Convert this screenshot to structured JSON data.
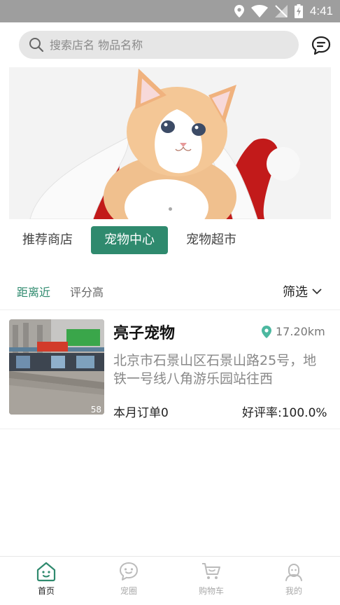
{
  "status_bar": {
    "time": "4:41"
  },
  "search": {
    "placeholder": "搜索店名 物品名称"
  },
  "icons": {
    "search": "search-icon",
    "message": "chat-bubble-icon",
    "location": "location-pin-icon",
    "filter_arrow": "chevron-down-icon"
  },
  "banner": {
    "subject": "kitten",
    "slide_count": 3,
    "active_slide": 2
  },
  "category_tabs": [
    {
      "label": "推荐商店"
    },
    {
      "label": "宠物中心"
    },
    {
      "label": "宠物超市"
    }
  ],
  "sort": {
    "nearest": "距离近",
    "top_rated": "评分高",
    "filter": "筛选"
  },
  "store": {
    "name": "亮子宠物",
    "distance": "17.20km",
    "address": "北京市石景山区石景山路25号，地铁一号线八角游乐园站往西",
    "monthly_orders": "本月订单0",
    "rating": "好评率:100.0%",
    "image_caption": "58"
  },
  "bottom_nav": [
    {
      "label": "首页",
      "icon": "home-icon"
    },
    {
      "label": "宠圈",
      "icon": "chat-bubble-icon"
    },
    {
      "label": "购物车",
      "icon": "cart-icon"
    },
    {
      "label": "我的",
      "icon": "profile-icon"
    }
  ],
  "colors": {
    "accent": "#2f8a6e",
    "pin": "#4cb8a0",
    "status_bar": "#9e9e9e"
  }
}
